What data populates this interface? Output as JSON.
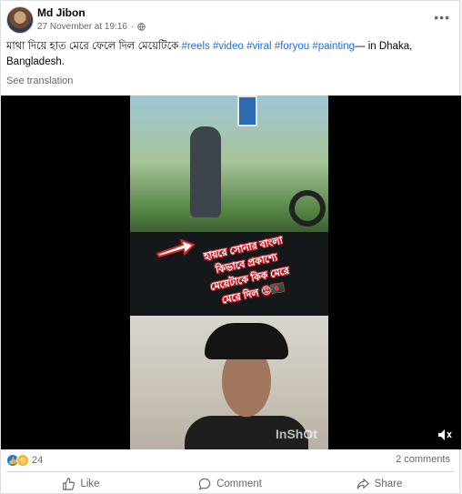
{
  "post": {
    "author": "Md Jibon",
    "timestamp": "27 November at 19:16",
    "dot": "·",
    "more_menu": "•••",
    "caption_text": "মাথা দিয়ে হাত মেরে ফেলে দিল মেয়েটিকে ",
    "hashtags": [
      "#reels",
      "#video",
      "#viral",
      "#foryou",
      "#painting"
    ],
    "location_prefix": "— in ",
    "location": "Dhaka, Bangladesh.",
    "see_translation": "See translation"
  },
  "video": {
    "overlay_lines": [
      "হায়রে সোনার বাংলা",
      "কিভাবে প্রকাশ্যে",
      "মেয়েটাকে কিক মেরে",
      "মেরে দিল 😡🇧🇩"
    ],
    "watermark": "InShOt"
  },
  "stats": {
    "reaction_count": "24",
    "comments_label": "2 comments"
  },
  "actions": {
    "like": "Like",
    "comment": "Comment",
    "share": "Share"
  },
  "icons": {
    "like": "like-icon",
    "comment": "comment-icon",
    "share": "share-icon",
    "globe": "globe-icon",
    "volume": "volume-icon"
  },
  "colors": {
    "link": "#216fdb",
    "muted": "#65676b",
    "like_blue": "#1877f2",
    "wow_yellow": "#f7b125"
  }
}
